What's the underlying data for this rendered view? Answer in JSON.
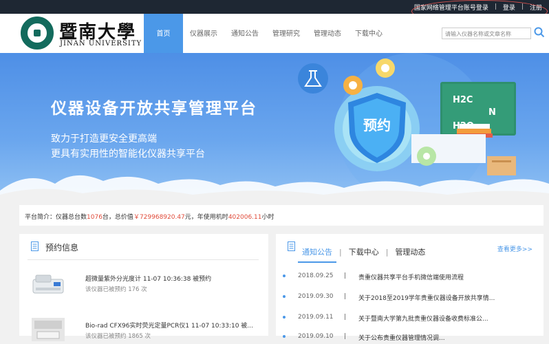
{
  "topbar": {
    "links": [
      "国家网络管理平台账号登录",
      "登录",
      "注册"
    ]
  },
  "header": {
    "brand_cn": "暨南大學",
    "brand_en": "JINAN UNIVERSITY",
    "nav": [
      "首页",
      "仪器展示",
      "通知公告",
      "管理研究",
      "管理动态",
      "下载中心"
    ],
    "search_placeholder": "请输入仪器名称或文章名称"
  },
  "banner": {
    "title": "仪器设备开放共享管理平台",
    "subtitle_1": "致力于打造更安全更高端",
    "subtitle_2": "更具有实用性的智能化仪器共享平台",
    "shield_text": "预约",
    "board_text_1": "H2C",
    "board_text_2": "N",
    "board_text_3": "H2O"
  },
  "intro": {
    "prefix": "平台简介：仪器总台数",
    "count": "1076",
    "count_unit": "台，总价值",
    "value": "￥729968920.47",
    "value_unit": "元，年使用机时",
    "hours": "402006.11",
    "hours_unit": "小时"
  },
  "booking": {
    "title": "预约信息",
    "items": [
      {
        "title": "超微量紫外分光度计 11-07 10:36:38 被预约",
        "sub": "该仪器已被预约 176 次"
      },
      {
        "title": "Bio-rad CFX96实时荧光定量PCR仪1 11-07 10:33:10 被...",
        "sub": "该仪器已被预约 1865 次"
      }
    ]
  },
  "news": {
    "tabs": [
      "通知公告",
      "下载中心",
      "管理动态"
    ],
    "more": "查看更多>>",
    "items": [
      {
        "date": "2018.09.25",
        "text": "贵重仪器共享平台手机微信端使用流程"
      },
      {
        "date": "2019.09.30",
        "text": "关于2018至2019学年贵重仪器设备开放共享情..."
      },
      {
        "date": "2019.09.11",
        "text": "关于暨南大学第九批贵重仪器设备收费标准公..."
      },
      {
        "date": "2019.09.10",
        "text": "关于公布贵重仪器管理情况调..."
      }
    ]
  },
  "colors": {
    "accent": "#4b98e8",
    "topbar": "#1e2733",
    "highlight": "#e04b3a"
  }
}
